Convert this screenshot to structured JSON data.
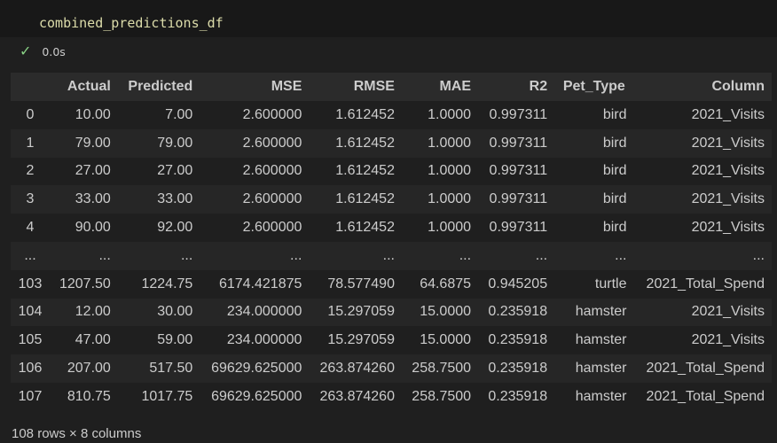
{
  "cell": {
    "code": "combined_predictions_df",
    "status_icon": "check-icon",
    "exec_time": "0.0s"
  },
  "table": {
    "columns": [
      "",
      "Actual",
      "Predicted",
      "MSE",
      "RMSE",
      "MAE",
      "R2",
      "Pet_Type",
      "Column"
    ],
    "rows": [
      [
        "0",
        "10.00",
        "7.00",
        "2.600000",
        "1.612452",
        "1.0000",
        "0.997311",
        "bird",
        "2021_Visits"
      ],
      [
        "1",
        "79.00",
        "79.00",
        "2.600000",
        "1.612452",
        "1.0000",
        "0.997311",
        "bird",
        "2021_Visits"
      ],
      [
        "2",
        "27.00",
        "27.00",
        "2.600000",
        "1.612452",
        "1.0000",
        "0.997311",
        "bird",
        "2021_Visits"
      ],
      [
        "3",
        "33.00",
        "33.00",
        "2.600000",
        "1.612452",
        "1.0000",
        "0.997311",
        "bird",
        "2021_Visits"
      ],
      [
        "4",
        "90.00",
        "92.00",
        "2.600000",
        "1.612452",
        "1.0000",
        "0.997311",
        "bird",
        "2021_Visits"
      ],
      [
        "...",
        "...",
        "...",
        "...",
        "...",
        "...",
        "...",
        "...",
        "..."
      ],
      [
        "103",
        "1207.50",
        "1224.75",
        "6174.421875",
        "78.577490",
        "64.6875",
        "0.945205",
        "turtle",
        "2021_Total_Spend"
      ],
      [
        "104",
        "12.00",
        "30.00",
        "234.000000",
        "15.297059",
        "15.0000",
        "0.235918",
        "hamster",
        "2021_Visits"
      ],
      [
        "105",
        "47.00",
        "59.00",
        "234.000000",
        "15.297059",
        "15.0000",
        "0.235918",
        "hamster",
        "2021_Visits"
      ],
      [
        "106",
        "207.00",
        "517.50",
        "69629.625000",
        "263.874260",
        "258.7500",
        "0.235918",
        "hamster",
        "2021_Total_Spend"
      ],
      [
        "107",
        "810.75",
        "1017.75",
        "69629.625000",
        "263.874260",
        "258.7500",
        "0.235918",
        "hamster",
        "2021_Total_Spend"
      ]
    ],
    "summary": "108 rows × 8 columns"
  }
}
